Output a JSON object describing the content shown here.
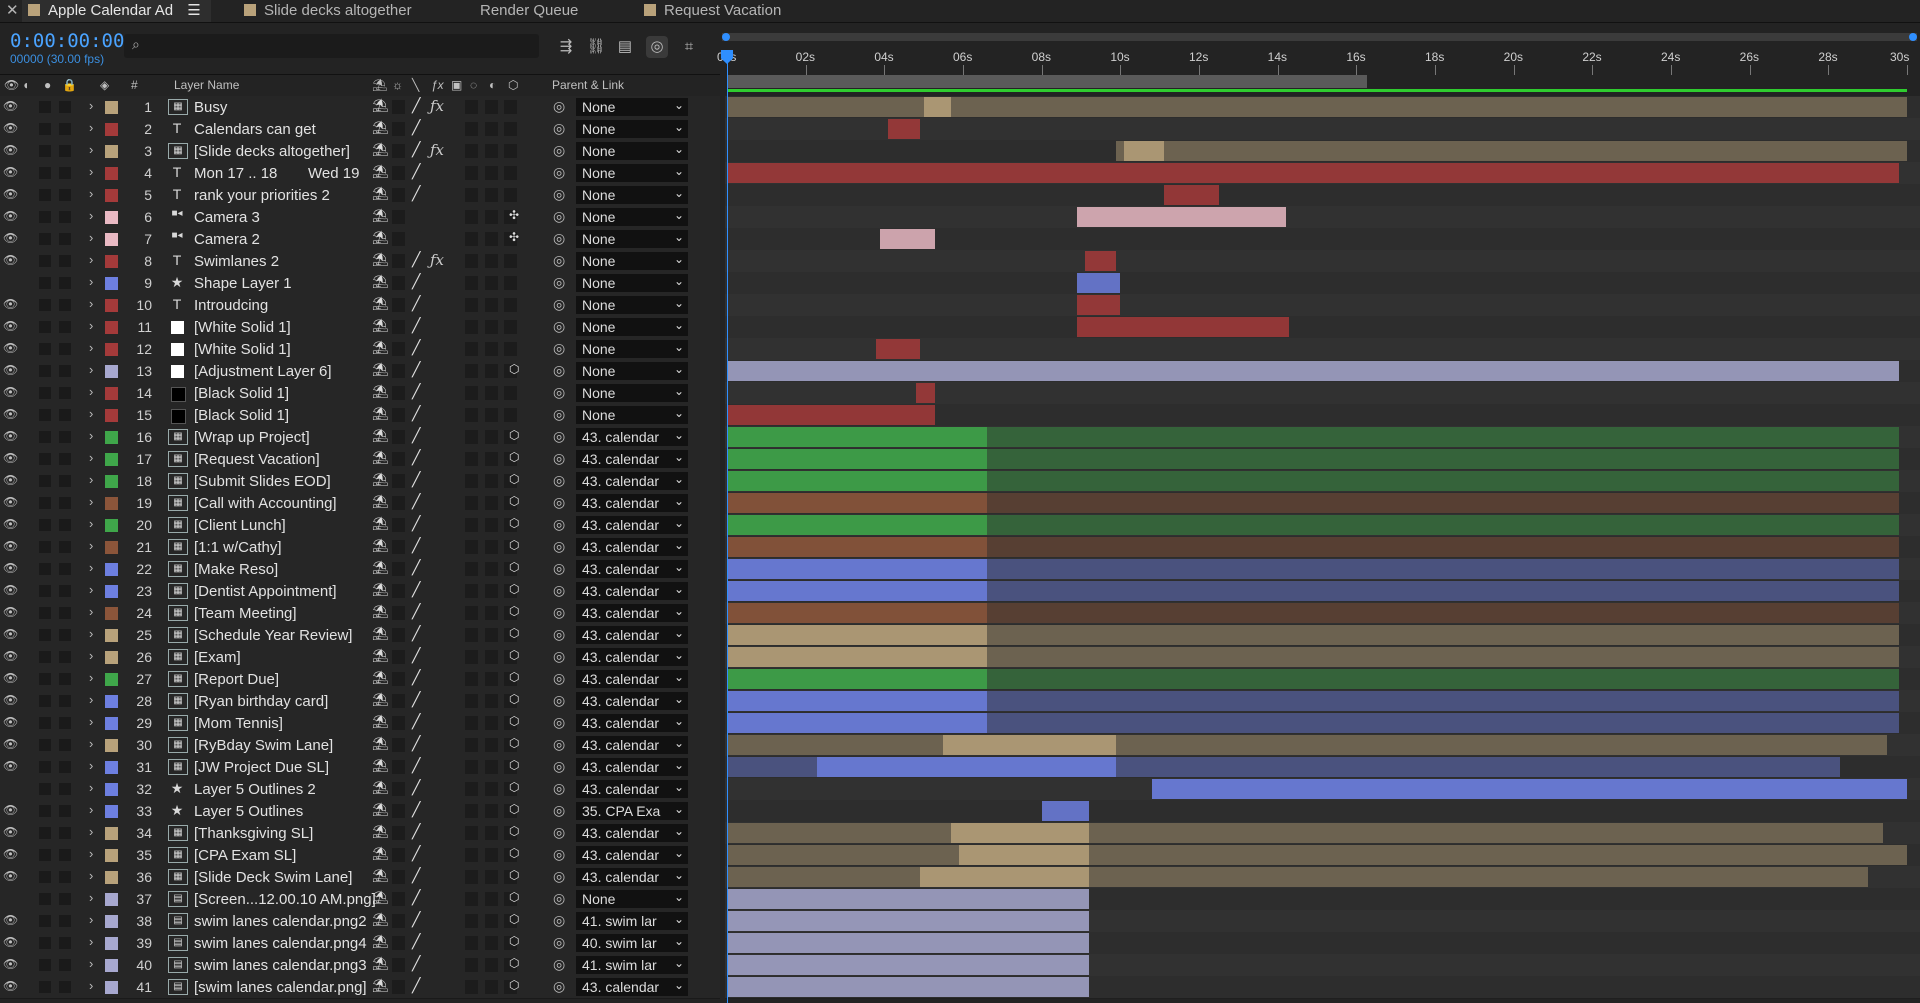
{
  "tabs": [
    {
      "label": "Apple Calendar Ad",
      "active": true
    },
    {
      "label": "Slide decks altogether",
      "active": false
    },
    {
      "label": "Render Queue",
      "active": false
    },
    {
      "label": "Request Vacation",
      "active": false
    }
  ],
  "timecode": "0:00:00:00",
  "fps": "00000 (30.00 fps)",
  "columns": {
    "number": "#",
    "layer_name": "Layer Name",
    "parent_link": "Parent & Link"
  },
  "ruler": {
    "ticks": [
      "00s",
      "02s",
      "04s",
      "06s",
      "08s",
      "10s",
      "12s",
      "14s",
      "16s",
      "18s",
      "20s",
      "22s",
      "24s",
      "26s",
      "28s",
      "30s"
    ],
    "duration_s": 30
  },
  "colors": {
    "red": "#a43a3a",
    "sand": "#b8a27b",
    "pink": "#e9b9c3",
    "blue": "#6d7fe0",
    "lilac": "#a7a8cf",
    "green": "#3fa64a",
    "brown": "#8b553a",
    "white": "#ffffff",
    "black": "#111111"
  },
  "layers": [
    {
      "num": "1",
      "type": "comp",
      "name": "Busy",
      "label": "sand",
      "parent": "None",
      "fx": true,
      "bar": [
        0,
        30
      ],
      "active": [
        5,
        5.7
      ]
    },
    {
      "num": "2",
      "type": "text",
      "name": "Calendars can get",
      "label": "red",
      "parent": "None",
      "bar": [
        4.1,
        4.9
      ]
    },
    {
      "num": "3",
      "type": "comp",
      "name": "[Slide decks altogether]",
      "label": "sand",
      "parent": "None",
      "fx": true,
      "bar": [
        9.9,
        30
      ],
      "active": [
        10.1,
        11.1
      ]
    },
    {
      "num": "4",
      "type": "text",
      "name": "Mon 17 .. 18",
      "name2": "Wed 19",
      "label": "red",
      "parent": "None",
      "bar": [
        0,
        29.8
      ]
    },
    {
      "num": "5",
      "type": "text",
      "name": "rank your priorities 2",
      "label": "red",
      "parent": "None",
      "bar": [
        11.1,
        12.5
      ]
    },
    {
      "num": "6",
      "type": "camera",
      "name": "Camera 3",
      "label": "pink",
      "parent": "None",
      "bar": [
        8.9,
        14.2
      ]
    },
    {
      "num": "7",
      "type": "camera",
      "name": "Camera 2",
      "label": "pink",
      "parent": "None",
      "bar": [
        3.9,
        5.3
      ]
    },
    {
      "num": "8",
      "type": "text",
      "name": "Swimlanes 2",
      "label": "red",
      "parent": "None",
      "fx": true,
      "bar": [
        9.1,
        9.9
      ]
    },
    {
      "num": "9",
      "type": "shape",
      "name": "Shape Layer 1",
      "label": "blue",
      "parent": "None",
      "bar": [
        8.9,
        10
      ]
    },
    {
      "num": "10",
      "type": "text",
      "name": "Introudcing",
      "label": "red",
      "parent": "None",
      "bar": [
        8.9,
        10
      ]
    },
    {
      "num": "11",
      "type": "solid",
      "name": "[White Solid 1]",
      "label": "red",
      "parent": "None",
      "bar": [
        8.9,
        14.3
      ]
    },
    {
      "num": "12",
      "type": "solid",
      "name": "[White Solid 1]",
      "label": "red",
      "parent": "None",
      "bar": [
        3.8,
        4.9
      ]
    },
    {
      "num": "13",
      "type": "solid",
      "name": "[Adjustment Layer 6]",
      "label": "lilac",
      "parent": "None",
      "bar": [
        0,
        29.8
      ]
    },
    {
      "num": "14",
      "type": "black",
      "name": "[Black Solid 1]",
      "label": "red",
      "parent": "None",
      "bar": [
        4.8,
        5.3
      ]
    },
    {
      "num": "15",
      "type": "black",
      "name": "[Black Solid 1]",
      "label": "red",
      "parent": "None",
      "bar": [
        0,
        5.3
      ]
    },
    {
      "num": "16",
      "type": "comp",
      "name": "[Wrap up Project]",
      "label": "green",
      "parent": "43. calendar",
      "bar": [
        0,
        29.8
      ],
      "active": [
        0,
        6.6
      ]
    },
    {
      "num": "17",
      "type": "comp",
      "name": "[Request Vacation]",
      "label": "green",
      "parent": "43. calendar",
      "bar": [
        0,
        29.8
      ],
      "active": [
        0,
        6.6
      ]
    },
    {
      "num": "18",
      "type": "comp",
      "name": "[Submit Slides EOD]",
      "label": "green",
      "parent": "43. calendar",
      "bar": [
        0,
        29.8
      ],
      "active": [
        0,
        6.6
      ]
    },
    {
      "num": "19",
      "type": "comp",
      "name": "[Call with Accounting]",
      "label": "brown",
      "parent": "43. calendar",
      "bar": [
        0,
        29.8
      ],
      "active": [
        0,
        6.6
      ]
    },
    {
      "num": "20",
      "type": "comp",
      "name": "[Client Lunch]",
      "label": "green",
      "parent": "43. calendar",
      "bar": [
        0,
        29.8
      ],
      "active": [
        0,
        6.6
      ]
    },
    {
      "num": "21",
      "type": "comp",
      "name": "[1:1 w/Cathy]",
      "label": "brown",
      "parent": "43. calendar",
      "bar": [
        0,
        29.8
      ],
      "active": [
        0,
        6.6
      ]
    },
    {
      "num": "22",
      "type": "comp",
      "name": "[Make Reso]",
      "label": "blue",
      "parent": "43. calendar",
      "bar": [
        0,
        29.8
      ],
      "active": [
        0,
        6.6
      ]
    },
    {
      "num": "23",
      "type": "comp",
      "name": "[Dentist Appointment]",
      "label": "blue",
      "parent": "43. calendar",
      "bar": [
        0,
        29.8
      ],
      "active": [
        0,
        6.6
      ]
    },
    {
      "num": "24",
      "type": "comp",
      "name": "[Team Meeting]",
      "label": "brown",
      "parent": "43. calendar",
      "bar": [
        0,
        29.8
      ],
      "active": [
        0,
        6.6
      ]
    },
    {
      "num": "25",
      "type": "comp",
      "name": "[Schedule Year Review]",
      "label": "sand",
      "parent": "43. calendar",
      "bar": [
        0,
        29.8
      ],
      "active": [
        0,
        6.6
      ]
    },
    {
      "num": "26",
      "type": "comp",
      "name": "[Exam]",
      "label": "sand",
      "parent": "43. calendar",
      "bar": [
        0,
        29.8
      ],
      "active": [
        0,
        6.6
      ]
    },
    {
      "num": "27",
      "type": "comp",
      "name": "[Report Due]",
      "label": "green",
      "parent": "43. calendar",
      "bar": [
        0,
        29.8
      ],
      "active": [
        0,
        6.6
      ]
    },
    {
      "num": "28",
      "type": "comp",
      "name": "[Ryan birthday card]",
      "label": "blue",
      "parent": "43. calendar",
      "bar": [
        0,
        29.8
      ],
      "active": [
        0,
        6.6
      ]
    },
    {
      "num": "29",
      "type": "comp",
      "name": "[Mom Tennis]",
      "label": "blue",
      "parent": "43. calendar",
      "bar": [
        0,
        29.8
      ],
      "active": [
        0,
        6.6
      ]
    },
    {
      "num": "30",
      "type": "comp",
      "name": "[RyBday Swim Lane]",
      "label": "sand",
      "parent": "43. calendar",
      "bar": [
        0,
        29.5
      ],
      "active": [
        5.5,
        9.9
      ]
    },
    {
      "num": "31",
      "type": "comp",
      "name": "[JW Project Due SL]",
      "label": "blue",
      "parent": "43. calendar",
      "bar": [
        0,
        28.3
      ],
      "active": [
        2.3,
        9.9
      ]
    },
    {
      "num": "32",
      "type": "star",
      "name": "Layer 5 Outlines 2",
      "label": "blue",
      "parent": "43. calendar",
      "bar": [
        10.8,
        30
      ],
      "active": [
        10.8,
        30
      ]
    },
    {
      "num": "33",
      "type": "star",
      "name": "Layer 5 Outlines",
      "label": "blue",
      "parent": "35. CPA Exa",
      "bar": [
        8,
        9.2
      ]
    },
    {
      "num": "34",
      "type": "comp",
      "name": "[Thanksgiving SL]",
      "label": "sand",
      "parent": "43. calendar",
      "bar": [
        0,
        29.4
      ],
      "active": [
        5.7,
        9.2
      ]
    },
    {
      "num": "35",
      "type": "comp",
      "name": "[CPA Exam SL]",
      "label": "sand",
      "parent": "43. calendar",
      "bar": [
        0,
        30
      ],
      "active": [
        5.9,
        9.2
      ]
    },
    {
      "num": "36",
      "type": "comp",
      "name": "[Slide Deck Swim Lane]",
      "label": "sand",
      "parent": "43. calendar",
      "bar": [
        0,
        29
      ],
      "active": [
        4.9,
        9.2
      ]
    },
    {
      "num": "37",
      "type": "file",
      "name": "[Screen...12.00.10 AM.png]",
      "label": "lilac",
      "parent": "None",
      "bar": [
        0,
        9.2
      ]
    },
    {
      "num": "38",
      "type": "file",
      "name": "swim lanes calendar.png2",
      "label": "lilac",
      "parent": "41. swim lar",
      "bar": [
        0,
        9.2
      ]
    },
    {
      "num": "39",
      "type": "file",
      "name": "swim lanes calendar.png4",
      "label": "lilac",
      "parent": "40. swim lar",
      "bar": [
        0,
        9.2
      ]
    },
    {
      "num": "40",
      "type": "file",
      "name": "swim lanes calendar.png3",
      "label": "lilac",
      "parent": "41. swim lar",
      "bar": [
        0,
        9.2
      ]
    },
    {
      "num": "41",
      "type": "file",
      "name": "[swim lanes calendar.png]",
      "label": "lilac",
      "parent": "43. calendar",
      "bar": [
        0,
        9.2
      ]
    }
  ]
}
